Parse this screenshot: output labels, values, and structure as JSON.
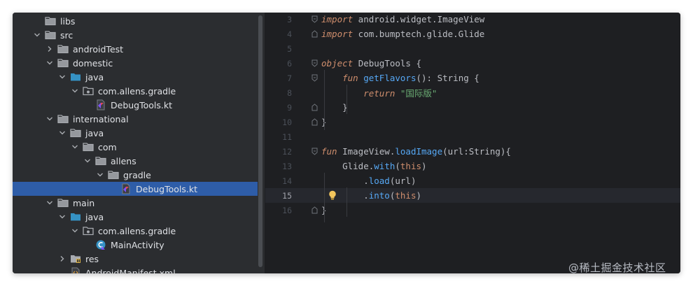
{
  "project_tree": {
    "items": [
      {
        "label": "libs",
        "depth": 1,
        "expander": "none",
        "icon": "folder-icon",
        "selected": false
      },
      {
        "label": "src",
        "depth": 1,
        "expander": "expanded",
        "icon": "folder-icon",
        "selected": false
      },
      {
        "label": "androidTest",
        "depth": 2,
        "expander": "collapsed",
        "icon": "folder-icon",
        "selected": false
      },
      {
        "label": "domestic",
        "depth": 2,
        "expander": "expanded",
        "icon": "folder-icon",
        "selected": false
      },
      {
        "label": "java",
        "depth": 3,
        "expander": "expanded",
        "icon": "source-folder-icon",
        "selected": false
      },
      {
        "label": "com.allens.gradle",
        "depth": 4,
        "expander": "expanded",
        "icon": "package-icon",
        "selected": false
      },
      {
        "label": "DebugTools.kt",
        "depth": 5,
        "expander": "none",
        "icon": "kotlin-file-icon",
        "selected": false
      },
      {
        "label": "international",
        "depth": 2,
        "expander": "expanded",
        "icon": "folder-icon",
        "selected": false
      },
      {
        "label": "java",
        "depth": 3,
        "expander": "expanded",
        "icon": "folder-icon",
        "selected": false
      },
      {
        "label": "com",
        "depth": 4,
        "expander": "expanded",
        "icon": "folder-icon",
        "selected": false
      },
      {
        "label": "allens",
        "depth": 5,
        "expander": "expanded",
        "icon": "folder-icon",
        "selected": false
      },
      {
        "label": "gradle",
        "depth": 6,
        "expander": "expanded",
        "icon": "folder-icon",
        "selected": false
      },
      {
        "label": "DebugTools.kt",
        "depth": 7,
        "expander": "none",
        "icon": "kotlin-file-icon",
        "selected": true
      },
      {
        "label": "main",
        "depth": 2,
        "expander": "expanded",
        "icon": "folder-icon",
        "selected": false
      },
      {
        "label": "java",
        "depth": 3,
        "expander": "expanded",
        "icon": "source-folder-icon",
        "selected": false
      },
      {
        "label": "com.allens.gradle",
        "depth": 4,
        "expander": "expanded",
        "icon": "package-icon",
        "selected": false
      },
      {
        "label": "MainActivity",
        "depth": 5,
        "expander": "none",
        "icon": "kotlin-class-icon",
        "selected": false
      },
      {
        "label": "res",
        "depth": 3,
        "expander": "collapsed",
        "icon": "resources-folder-icon",
        "selected": false
      },
      {
        "label": "AndroidManifest.xml",
        "depth": 3,
        "expander": "none",
        "icon": "xml-file-icon",
        "selected": false
      }
    ]
  },
  "editor": {
    "current_line": 15,
    "lines": [
      {
        "num": "3",
        "fold": "start",
        "tokens": [
          [
            "kwi",
            "import"
          ],
          [
            "code",
            " android.widget."
          ],
          [
            "cls",
            "ImageView"
          ]
        ]
      },
      {
        "num": "4",
        "fold": "end",
        "tokens": [
          [
            "kwi",
            "import"
          ],
          [
            "code",
            " com.bumptech.glide."
          ],
          [
            "cls",
            "Glide"
          ]
        ]
      },
      {
        "num": "5",
        "fold": "",
        "tokens": []
      },
      {
        "num": "6",
        "fold": "start",
        "tokens": [
          [
            "kwi",
            "object"
          ],
          [
            "code",
            " "
          ],
          [
            "cls",
            "DebugTools"
          ],
          [
            "code",
            " {"
          ]
        ]
      },
      {
        "num": "7",
        "fold": "start",
        "tokens": [
          [
            "code",
            "    "
          ],
          [
            "kwi",
            "fun"
          ],
          [
            "code",
            " "
          ],
          [
            "fn",
            "getFlavors"
          ],
          [
            "code",
            "(): String {"
          ]
        ]
      },
      {
        "num": "8",
        "fold": "",
        "tokens": [
          [
            "code",
            "        "
          ],
          [
            "kwi",
            "return"
          ],
          [
            "code",
            " "
          ],
          [
            "str",
            "\"国际版\""
          ]
        ]
      },
      {
        "num": "9",
        "fold": "end",
        "tokens": [
          [
            "code",
            "    }"
          ]
        ]
      },
      {
        "num": "10",
        "fold": "end",
        "tokens": [
          [
            "code",
            "}"
          ]
        ]
      },
      {
        "num": "11",
        "fold": "",
        "tokens": []
      },
      {
        "num": "12",
        "fold": "start",
        "tokens": [
          [
            "kwi",
            "fun"
          ],
          [
            "code",
            " ImageView."
          ],
          [
            "fn",
            "loadImage"
          ],
          [
            "code",
            "(url:String){"
          ]
        ]
      },
      {
        "num": "13",
        "fold": "",
        "tokens": [
          [
            "code",
            "    Glide."
          ],
          [
            "fn",
            "with"
          ],
          [
            "code",
            "("
          ],
          [
            "this",
            "this"
          ],
          [
            "code",
            ")"
          ]
        ]
      },
      {
        "num": "14",
        "fold": "",
        "tokens": [
          [
            "code",
            "        ."
          ],
          [
            "fn",
            "load"
          ],
          [
            "code",
            "(url)"
          ]
        ]
      },
      {
        "num": "15",
        "fold": "",
        "tokens": [
          [
            "code",
            "        ."
          ],
          [
            "fn",
            "into"
          ],
          [
            "code",
            "("
          ],
          [
            "this",
            "this"
          ],
          [
            "code",
            ")"
          ]
        ]
      },
      {
        "num": "16",
        "fold": "end",
        "tokens": [
          [
            "code",
            "}"
          ]
        ]
      }
    ],
    "intention_bulb_icon": "lightbulb-icon"
  },
  "watermark": "@稀土掘金技术社区",
  "colors": {
    "tree_bg": "#2b2d30",
    "editor_bg": "#1e1f22",
    "selection": "#2e5da8",
    "keyword": "#cf8e6d",
    "function": "#56a8f5",
    "string": "#6aab73",
    "text": "#bcbec4",
    "folder": "#a8abb0",
    "source_folder": "#3592c4",
    "kotlin": "#7f52ff",
    "bulb": "#f2c55c"
  }
}
